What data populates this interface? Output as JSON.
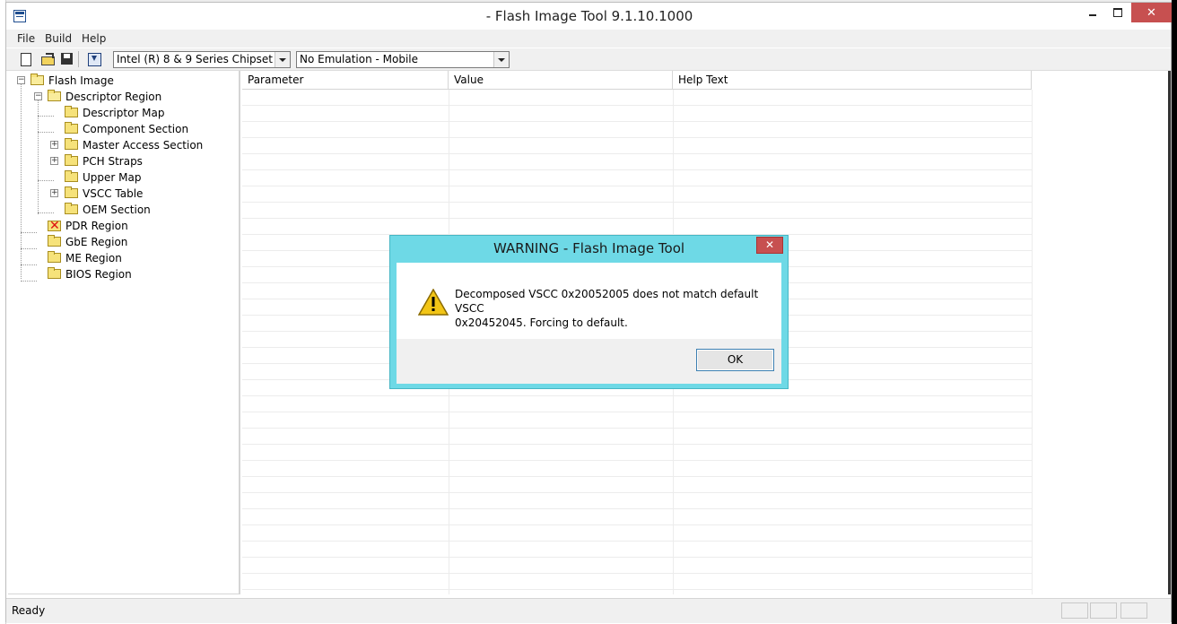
{
  "window": {
    "title": "- Flash Image Tool 9.1.10.1000",
    "app_icon": "flash-image-tool-icon",
    "controls": [
      "minimize-icon",
      "maximize-icon",
      "close-icon"
    ]
  },
  "menu": {
    "items": [
      {
        "label": "File"
      },
      {
        "label": "Build"
      },
      {
        "label": "Help"
      }
    ]
  },
  "toolbar": {
    "icons": [
      "new-document-icon",
      "open-folder-icon",
      "save-icon",
      "build-image-icon"
    ],
    "chipset": {
      "value": "Intel (R) 8 & 9 Series Chipset"
    },
    "emulation": {
      "value": "No Emulation - Mobile"
    }
  },
  "tree": {
    "root": {
      "label": "Flash Image"
    },
    "descriptor": {
      "label": "Descriptor Region"
    },
    "descriptor_children": [
      {
        "label": "Descriptor Map"
      },
      {
        "label": "Component Section"
      },
      {
        "label": "Master Access Section"
      },
      {
        "label": "PCH Straps"
      },
      {
        "label": "Upper Map"
      },
      {
        "label": "VSCC Table"
      },
      {
        "label": "OEM Section"
      }
    ],
    "regions": [
      {
        "label": "PDR Region"
      },
      {
        "label": "GbE Region"
      },
      {
        "label": "ME Region"
      },
      {
        "label": "BIOS Region"
      }
    ]
  },
  "grid": {
    "columns": [
      {
        "label": "Parameter"
      },
      {
        "label": "Value"
      },
      {
        "label": "Help Text"
      }
    ]
  },
  "status": {
    "text": "Ready"
  },
  "dialog": {
    "title": "WARNING - Flash Image Tool",
    "message": "Decomposed VSCC 0x20052005 does not match default VSCC\n0x20452045.  Forcing to default.",
    "ok_label": "OK",
    "icon": "warning-icon",
    "accent_color": "#6ed9e6"
  }
}
